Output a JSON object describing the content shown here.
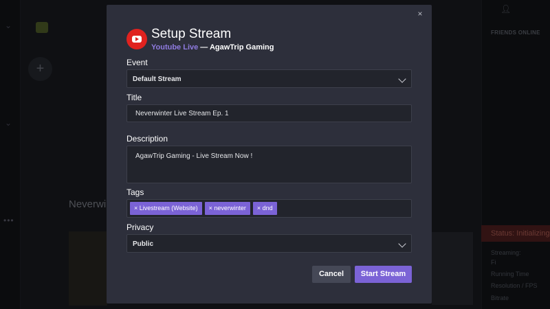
{
  "modal": {
    "title": "Setup Stream",
    "platform": "Youtube Live",
    "separator": " — ",
    "channel": "AgawTrip Gaming",
    "close_glyph": "×",
    "fields": {
      "event_label": "Event",
      "event_value": "Default Stream",
      "title_label": "Title",
      "title_value": "Neverwinter Live Stream Ep. 1",
      "description_label": "Description",
      "description_value": "AgawTrip Gaming - Live Stream Now !",
      "tags_label": "Tags",
      "tags": [
        "× Livestream (Website)",
        "× neverwinter",
        "× dnd"
      ],
      "privacy_label": "Privacy",
      "privacy_value": "Public"
    },
    "buttons": {
      "cancel": "Cancel",
      "start": "Start Stream"
    }
  },
  "background": {
    "add_glyph": "+",
    "stream_title": "Neverwi",
    "friends_header": "FRIENDS ONLINE",
    "status": "Status: Initializing",
    "side_lines": [
      "Streaming:",
      "Fi",
      "Running Time",
      "Resolution / FPS",
      "Bitrate"
    ]
  },
  "colors": {
    "accent": "#7b63d6",
    "platform_text": "#8f7be0",
    "youtube_red": "#e0221f",
    "modal_bg": "#2d2f3b",
    "field_bg": "#22242c"
  },
  "icons": {
    "platform": "youtube-icon",
    "close": "close-icon",
    "dropdown": "chevron-down-icon"
  }
}
